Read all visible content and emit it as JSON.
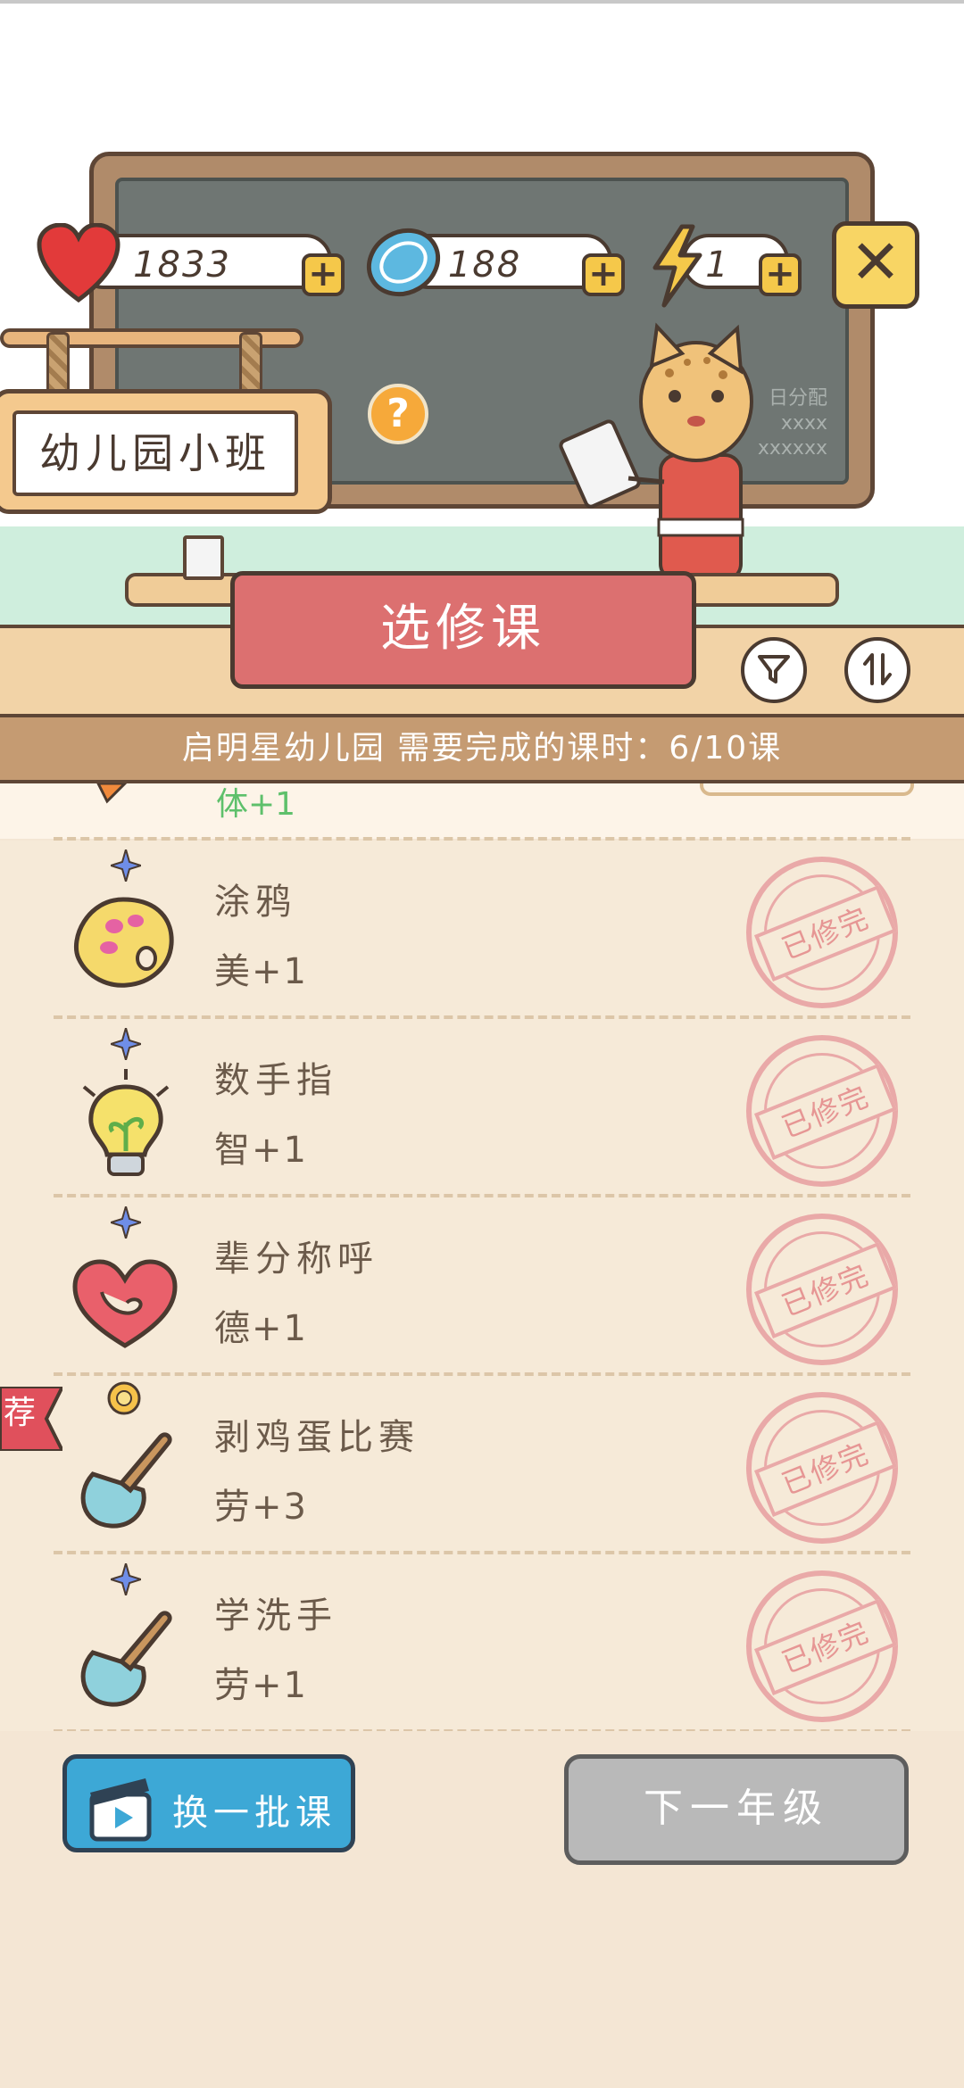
{
  "stats": {
    "hearts": "1833",
    "coins": "188",
    "energy": "1"
  },
  "class_sign": "幼儿园小班",
  "help_label": "?",
  "close_label": "✕",
  "banner_title": "选修课",
  "blackboard_text": [
    "日分配",
    "xxxx",
    "xxxxxx"
  ],
  "info_bar": "启明星幼儿园 需要完成的课时：6/10课",
  "partial_item_attr": "体+1",
  "courses": [
    {
      "name": "涂鸦",
      "attr": "美+1",
      "stamp": "已修完",
      "icon": "palette-icon",
      "badge": "blue-star"
    },
    {
      "name": "数手指",
      "attr": "智+1",
      "stamp": "已修完",
      "icon": "lightbulb-icon",
      "badge": "blue-star"
    },
    {
      "name": "辈分称呼",
      "attr": "德+1",
      "stamp": "已修完",
      "icon": "heart-hands-icon",
      "badge": "blue-star"
    },
    {
      "name": "剥鸡蛋比赛",
      "attr": "劳+3",
      "stamp": "已修完",
      "icon": "shovel-icon",
      "badge": "gold-flower",
      "tag": "荐"
    },
    {
      "name": "学洗手",
      "attr": "劳+1",
      "stamp": "已修完",
      "icon": "shovel-icon",
      "badge": "blue-star"
    }
  ],
  "buttons": {
    "swap": "换一批课",
    "next_grade": "下一年级"
  },
  "colors": {
    "banner_red": "#dc7070",
    "swap_blue": "#3da8d6",
    "background": "#f4e6d4",
    "attr_green": "#5ec06b"
  }
}
